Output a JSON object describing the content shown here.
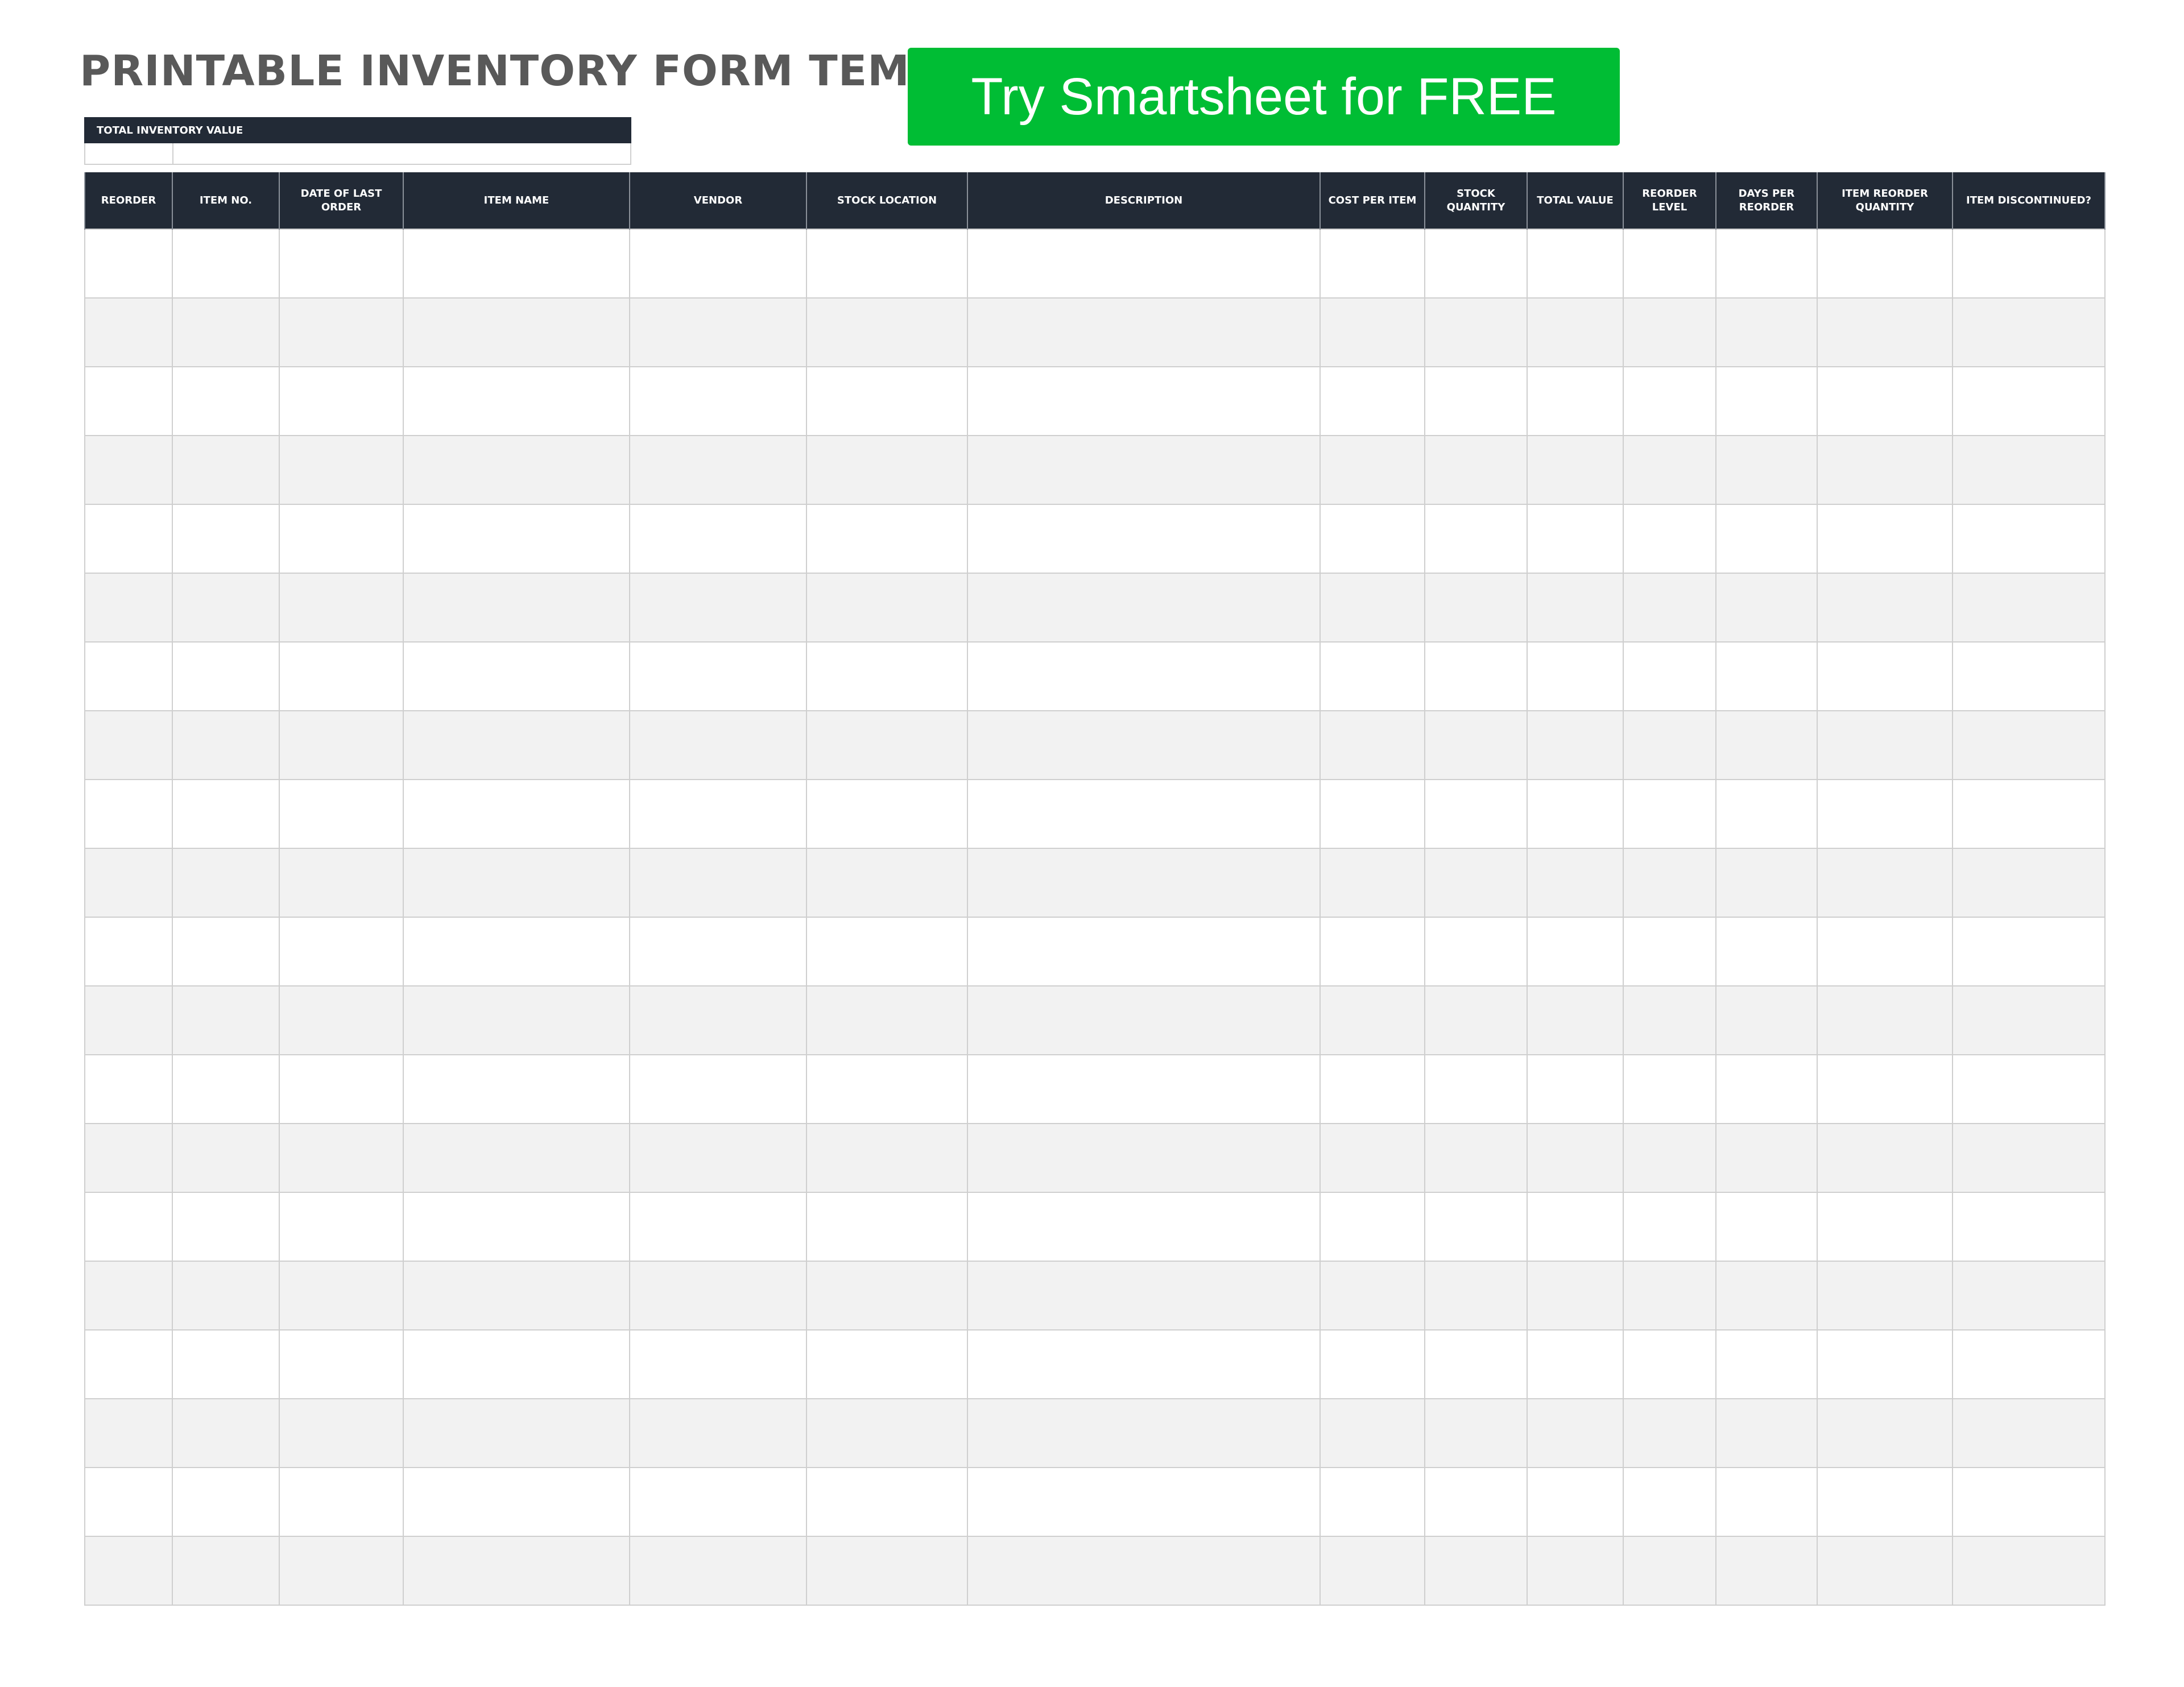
{
  "title": "PRINTABLE INVENTORY FORM TEMPLATE",
  "cta": {
    "label": "Try Smartsheet for FREE",
    "color": "#00bd34"
  },
  "summary": {
    "label": "TOTAL INVENTORY VALUE"
  },
  "colors": {
    "header_bg": "#222a36",
    "header_text": "#ffffff",
    "row_alt": "#f2f2f2",
    "grid": "#cfcfcf",
    "title": "#595959"
  },
  "table": {
    "columns": [
      "REORDER",
      "ITEM NO.",
      "DATE OF LAST ORDER",
      "ITEM NAME",
      "VENDOR",
      "STOCK LOCATION",
      "DESCRIPTION",
      "COST PER ITEM",
      "STOCK QUANTITY",
      "TOTAL VALUE",
      "REORDER LEVEL",
      "DAYS PER\nREORDER",
      "ITEM REORDER\nQUANTITY",
      "ITEM DISCONTINUED?"
    ],
    "rows": [
      [
        "",
        "",
        "",
        "",
        "",
        "",
        "",
        "",
        "",
        "",
        "",
        "",
        "",
        ""
      ],
      [
        "",
        "",
        "",
        "",
        "",
        "",
        "",
        "",
        "",
        "",
        "",
        "",
        "",
        ""
      ],
      [
        "",
        "",
        "",
        "",
        "",
        "",
        "",
        "",
        "",
        "",
        "",
        "",
        "",
        ""
      ],
      [
        "",
        "",
        "",
        "",
        "",
        "",
        "",
        "",
        "",
        "",
        "",
        "",
        "",
        ""
      ],
      [
        "",
        "",
        "",
        "",
        "",
        "",
        "",
        "",
        "",
        "",
        "",
        "",
        "",
        ""
      ],
      [
        "",
        "",
        "",
        "",
        "",
        "",
        "",
        "",
        "",
        "",
        "",
        "",
        "",
        ""
      ],
      [
        "",
        "",
        "",
        "",
        "",
        "",
        "",
        "",
        "",
        "",
        "",
        "",
        "",
        ""
      ],
      [
        "",
        "",
        "",
        "",
        "",
        "",
        "",
        "",
        "",
        "",
        "",
        "",
        "",
        ""
      ],
      [
        "",
        "",
        "",
        "",
        "",
        "",
        "",
        "",
        "",
        "",
        "",
        "",
        "",
        ""
      ],
      [
        "",
        "",
        "",
        "",
        "",
        "",
        "",
        "",
        "",
        "",
        "",
        "",
        "",
        ""
      ],
      [
        "",
        "",
        "",
        "",
        "",
        "",
        "",
        "",
        "",
        "",
        "",
        "",
        "",
        ""
      ],
      [
        "",
        "",
        "",
        "",
        "",
        "",
        "",
        "",
        "",
        "",
        "",
        "",
        "",
        ""
      ],
      [
        "",
        "",
        "",
        "",
        "",
        "",
        "",
        "",
        "",
        "",
        "",
        "",
        "",
        ""
      ],
      [
        "",
        "",
        "",
        "",
        "",
        "",
        "",
        "",
        "",
        "",
        "",
        "",
        "",
        ""
      ],
      [
        "",
        "",
        "",
        "",
        "",
        "",
        "",
        "",
        "",
        "",
        "",
        "",
        "",
        ""
      ],
      [
        "",
        "",
        "",
        "",
        "",
        "",
        "",
        "",
        "",
        "",
        "",
        "",
        "",
        ""
      ],
      [
        "",
        "",
        "",
        "",
        "",
        "",
        "",
        "",
        "",
        "",
        "",
        "",
        "",
        ""
      ],
      [
        "",
        "",
        "",
        "",
        "",
        "",
        "",
        "",
        "",
        "",
        "",
        "",
        "",
        ""
      ],
      [
        "",
        "",
        "",
        "",
        "",
        "",
        "",
        "",
        "",
        "",
        "",
        "",
        "",
        ""
      ],
      [
        "",
        "",
        "",
        "",
        "",
        "",
        "",
        "",
        "",
        "",
        "",
        "",
        "",
        ""
      ]
    ]
  }
}
